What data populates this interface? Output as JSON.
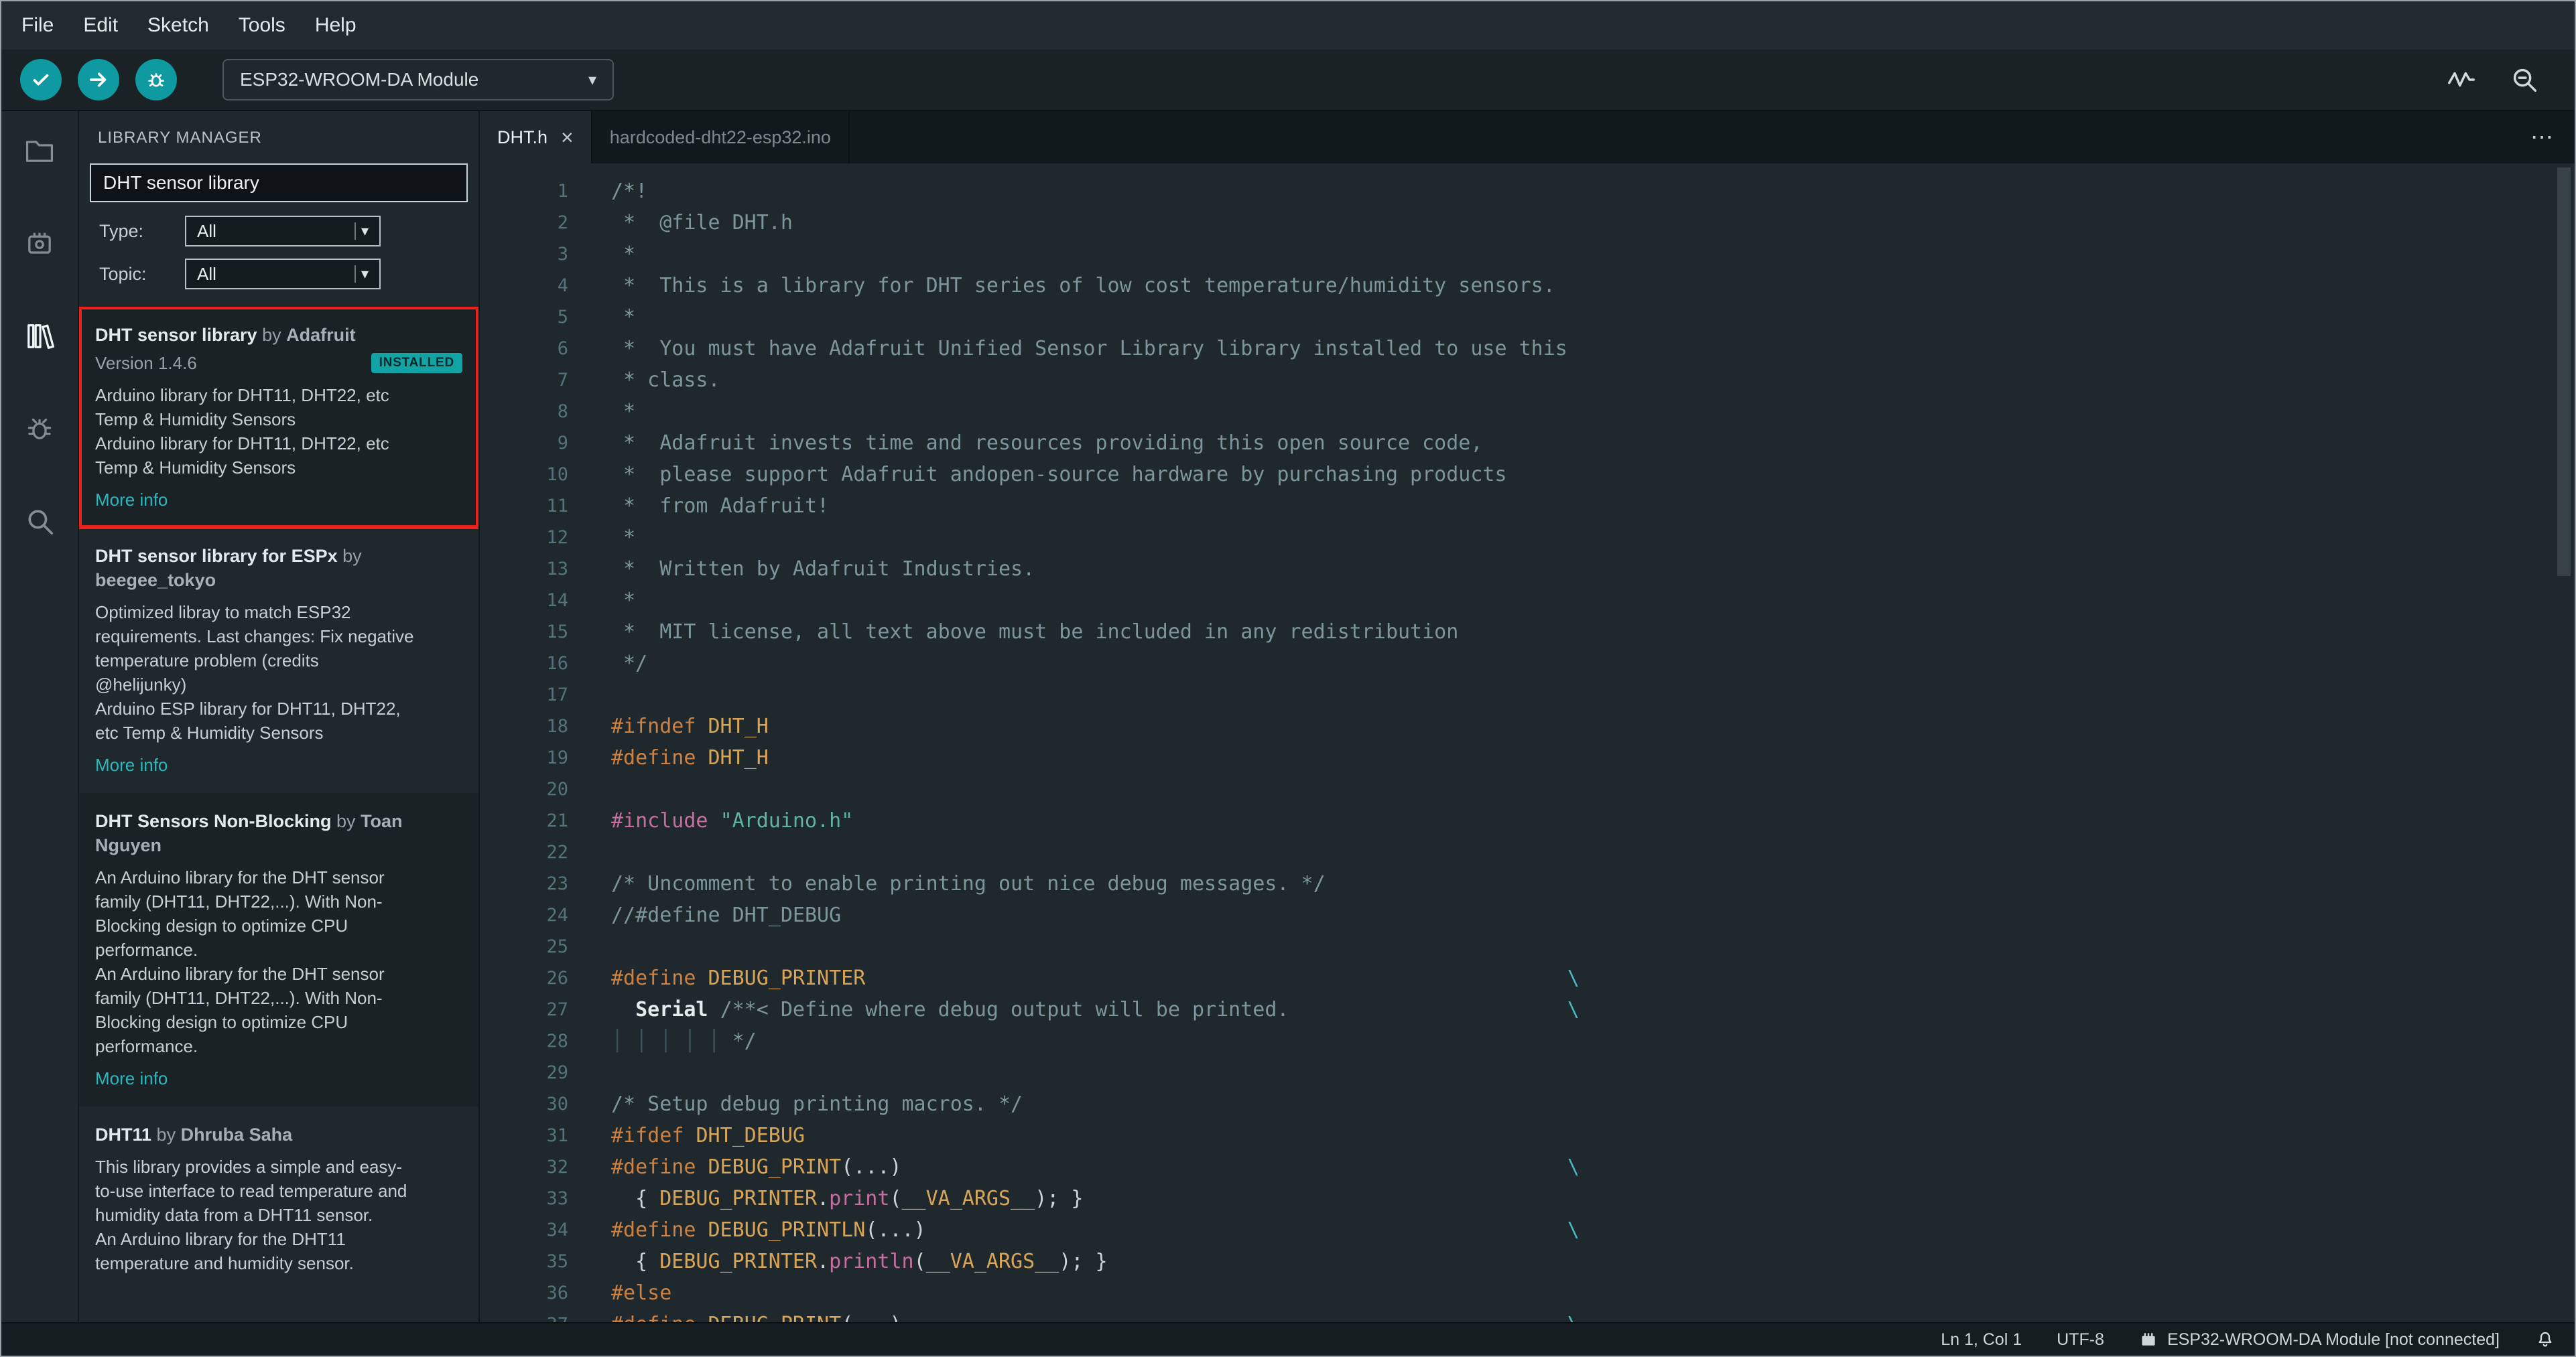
{
  "menu": {
    "items": [
      "File",
      "Edit",
      "Sketch",
      "Tools",
      "Help"
    ]
  },
  "toolbar": {
    "board_selector": "ESP32-WROOM-DA Module"
  },
  "icons": {
    "close": "×",
    "more": "⋯",
    "caret_down": "▾"
  },
  "library_manager": {
    "title": "LIBRARY MANAGER",
    "search_value": "DHT sensor library",
    "by_label": "by",
    "filters": {
      "type_label": "Type:",
      "type_value": "All",
      "topic_label": "Topic:",
      "topic_value": "All"
    },
    "items": [
      {
        "name": "DHT sensor library",
        "author": "Adafruit",
        "version": "Version 1.4.6",
        "installed_badge": "INSTALLED",
        "description": [
          "Arduino library for DHT11, DHT22, etc Temp & Humidity Sensors",
          "Arduino library for DHT11, DHT22, etc Temp & Humidity Sensors"
        ],
        "more_info": "More info",
        "highlighted": true
      },
      {
        "name": "DHT sensor library for ESPx",
        "author": "beegee_tokyo",
        "description": [
          "Optimized libray to match ESP32 requirements. Last changes: Fix negative temperature problem (credits @helijunky)",
          "Arduino ESP library for DHT11, DHT22, etc Temp & Humidity Sensors"
        ],
        "more_info": "More info",
        "highlighted": false
      },
      {
        "name": "DHT Sensors Non-Blocking",
        "author": "Toan Nguyen",
        "description": [
          "An Arduino library for the DHT sensor family (DHT11, DHT22,...). With Non-Blocking design to optimize CPU performance.",
          "An Arduino library for the DHT sensor family (DHT11, DHT22,...). With Non-Blocking design to optimize CPU performance."
        ],
        "more_info": "More info",
        "highlighted": false
      },
      {
        "name": "DHT11",
        "author": "Dhruba Saha",
        "description": [
          "This library provides a simple and easy-to-use interface to read temperature and humidity data from a DHT11 sensor.",
          "An Arduino library for the DHT11 temperature and humidity sensor."
        ],
        "more_info": null,
        "highlighted": false
      }
    ]
  },
  "editor": {
    "tabs": [
      {
        "label": "DHT.h",
        "active": true
      },
      {
        "label": "hardcoded-dht22-esp32.ino",
        "active": false
      }
    ],
    "code": {
      "lines": [
        [
          [
            "/*!",
            "c"
          ]
        ],
        [
          [
            " *  @file DHT.h",
            "c"
          ]
        ],
        [
          [
            " *",
            "c"
          ]
        ],
        [
          [
            " *  This is a library for DHT series of low cost temperature/humidity sensors.",
            "c"
          ]
        ],
        [
          [
            " *",
            "c"
          ]
        ],
        [
          [
            " *  You must have Adafruit Unified Sensor Library library installed to use this",
            "c"
          ]
        ],
        [
          [
            " * class.",
            "c"
          ]
        ],
        [
          [
            " *",
            "c"
          ]
        ],
        [
          [
            " *  Adafruit invests time and resources providing this open source code,",
            "c"
          ]
        ],
        [
          [
            " *  please support Adafruit andopen-source hardware by purchasing products",
            "c"
          ]
        ],
        [
          [
            " *  from Adafruit!",
            "c"
          ]
        ],
        [
          [
            " *",
            "c"
          ]
        ],
        [
          [
            " *  Written by Adafruit Industries.",
            "c"
          ]
        ],
        [
          [
            " *",
            "c"
          ]
        ],
        [
          [
            " *  MIT license, all text above must be included in any redistribution",
            "c"
          ]
        ],
        [
          [
            " */",
            "c"
          ]
        ],
        [],
        [
          [
            "#ifndef",
            "d"
          ],
          [
            " ",
            "p"
          ],
          [
            "DHT_H",
            "m"
          ]
        ],
        [
          [
            "#define",
            "d"
          ],
          [
            " ",
            "p"
          ],
          [
            "DHT_H",
            "m"
          ]
        ],
        [],
        [
          [
            "#include",
            "i"
          ],
          [
            " ",
            "p"
          ],
          [
            "\"Arduino.h\"",
            "s"
          ]
        ],
        [],
        [
          [
            "/* Uncomment to enable printing out nice debug messages. */",
            "c"
          ]
        ],
        [
          [
            "//#define DHT_DEBUG",
            "c"
          ]
        ],
        [],
        [
          [
            "#define",
            "d"
          ],
          [
            " ",
            "p"
          ],
          [
            "DEBUG_PRINTER",
            "m"
          ],
          [
            "",
            "p",
            58
          ],
          [
            "\\",
            "b"
          ]
        ],
        [
          [
            "  ",
            "p"
          ],
          [
            "Serial",
            "k"
          ],
          [
            " ",
            "p"
          ],
          [
            "/**< Define where debug output will be printed.",
            "c"
          ],
          [
            "",
            "c",
            23
          ],
          [
            "\\",
            "b"
          ]
        ],
        [
          [
            "│ │ │ │ │ ",
            "g"
          ],
          [
            "*/",
            "c"
          ]
        ],
        [],
        [
          [
            "/* Setup debug printing macros. */",
            "c"
          ]
        ],
        [
          [
            "#ifdef",
            "d"
          ],
          [
            " ",
            "p"
          ],
          [
            "DHT_DEBUG",
            "m"
          ]
        ],
        [
          [
            "#define",
            "d"
          ],
          [
            " ",
            "p"
          ],
          [
            "DEBUG_PRINT",
            "m"
          ],
          [
            "(...)",
            "p"
          ],
          [
            "",
            "p",
            55
          ],
          [
            "\\",
            "b"
          ]
        ],
        [
          [
            "  { ",
            "p"
          ],
          [
            "DEBUG_PRINTER",
            "m"
          ],
          [
            ".",
            "p"
          ],
          [
            "print",
            "f"
          ],
          [
            "(",
            "p"
          ],
          [
            "__VA_ARGS__",
            "m"
          ],
          [
            "); }",
            "p"
          ]
        ],
        [
          [
            "#define",
            "d"
          ],
          [
            " ",
            "p"
          ],
          [
            "DEBUG_PRINTLN",
            "m"
          ],
          [
            "(...)",
            "p"
          ],
          [
            "",
            "p",
            53
          ],
          [
            "\\",
            "b"
          ]
        ],
        [
          [
            "  { ",
            "p"
          ],
          [
            "DEBUG_PRINTER",
            "m"
          ],
          [
            ".",
            "p"
          ],
          [
            "println",
            "f"
          ],
          [
            "(",
            "p"
          ],
          [
            "__VA_ARGS__",
            "m"
          ],
          [
            "); }",
            "p"
          ]
        ],
        [
          [
            "#else",
            "d"
          ]
        ],
        [
          [
            "#define",
            "d"
          ],
          [
            " ",
            "p"
          ],
          [
            "DEBUG_PRINT",
            "m"
          ],
          [
            "(...)",
            "p"
          ],
          [
            "",
            "p",
            55
          ],
          [
            "\\",
            "b"
          ]
        ]
      ]
    }
  },
  "status_bar": {
    "cursor_position": "Ln 1, Col 1",
    "encoding": "UTF-8",
    "board_status": "ESP32-WROOM-DA Module [not connected]"
  },
  "colors": {
    "accent_teal": "#0e9aa0",
    "badge_teal": "#12a3a4",
    "link_teal": "#2db7bd",
    "annotation_red": "#e9221c"
  }
}
